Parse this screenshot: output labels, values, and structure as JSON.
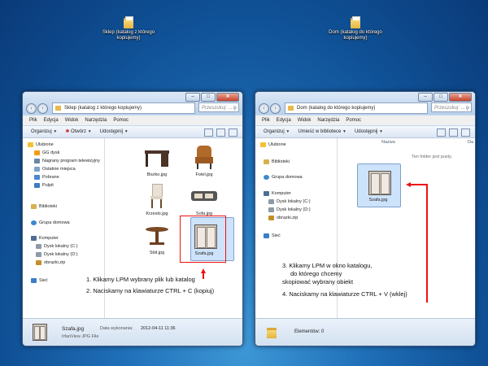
{
  "desktop_icons": [
    {
      "label": "Sklep (katalog z którego kopiujemy)"
    },
    {
      "label": "Dom (katalog do którego kopiujemy)"
    }
  ],
  "left_window": {
    "address": "Sklep (katalog z którego kopiujemy)",
    "search_placeholder": "Przeszukuj: ...",
    "menu": [
      "Plik",
      "Edycja",
      "Widok",
      "Narzędzia",
      "Pomoc"
    ],
    "toolbar": [
      "Organizuj",
      "Otwórz",
      "Udostępnij"
    ],
    "nav": {
      "favorites": "Ulubione",
      "favorites_items": [
        "GG dysk",
        "Nagrany program telewizyjny",
        "Ostatnie miejsca",
        "Pobrane",
        "Pulpit"
      ],
      "libraries": "Biblioteki",
      "homegroup": "Grupa domowa",
      "computer": "Komputer",
      "computer_items": [
        "Dysk lokalny (C:)",
        "Dysk lokalny (D:)",
        "obrazki.zip"
      ],
      "network": "Sieć"
    },
    "files": [
      "Biurko.jpg",
      "Fotel.jpg",
      "Krzeslo.jpg",
      "Sofa.jpg",
      "Stół.jpg",
      "Szafa.jpg"
    ],
    "status": {
      "filename": "Szafa.jpg",
      "date_label": "Data wykonania:",
      "date": "2012-04-11 11:36",
      "type": "IrfanView JPG File"
    },
    "annotations": [
      "1. Klikamy LPM wybrany plik lub katalog",
      "2. Naciskamy na klawiaturze CTRL + C (kopiuj)"
    ]
  },
  "right_window": {
    "address": "Dom (katalog do którego kopiujemy)",
    "search_placeholder": "Przeszukuj: ...",
    "menu": [
      "Plik",
      "Edycja",
      "Widok",
      "Narzędzia",
      "Pomoc"
    ],
    "toolbar": [
      "Organizuj",
      "Umieść w bibliotece",
      "Udostępnij"
    ],
    "nav": {
      "favorites": "Ulubione",
      "libraries": "Biblioteki",
      "homegroup": "Grupa domowa",
      "computer": "Komputer",
      "computer_items": [
        "Dysk lokalny (C:)",
        "Dysk lokalny (D:)",
        "obrazki.zip"
      ],
      "network": "Sieć"
    },
    "column_name": "Nazwa",
    "column_date": "Da",
    "empty_text": "Ten folder jest pusty.",
    "files": [
      "Szafa.jpg"
    ],
    "status": {
      "text": "Elementów: 0"
    },
    "annotations": [
      "3. Klikamy LPM w okno katalogu,",
      "do którego chcemy",
      "skopiować wybrany obiekt",
      "4. Naciskamy na klawiaturze CTRL + V (wklej)"
    ]
  },
  "colors": {
    "accent_red": "#e11111",
    "selection": "#cde3fb"
  }
}
